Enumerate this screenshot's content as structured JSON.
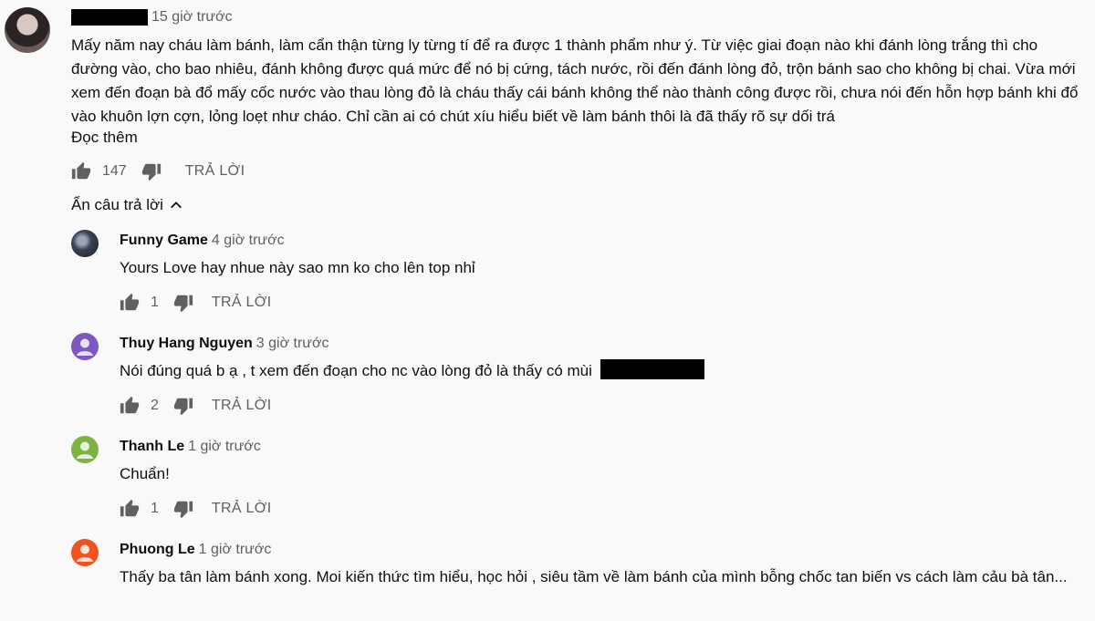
{
  "top_comment": {
    "time": "15 giờ trước",
    "text": "Mấy năm nay cháu làm bánh, làm cẩn thận từng ly từng tí để ra được 1 thành phẩm như ý. Từ việc giai đoạn nào khi đánh lòng trắng thì cho đường vào, cho bao nhiêu, đánh không được quá mức để nó bị cứng, tách nước, rồi đến đánh lòng đỏ, trộn bánh sao cho không bị chai. Vừa mới xem đến đoạn bà đổ mấy cốc nước vào thau lòng đỏ là cháu thấy cái bánh không thể nào thành công được rồi, chưa nói đến hỗn hợp bánh khi đổ vào khuôn lợn cợn, lỏng loẹt như cháo. Chỉ cần ai có chút xíu hiểu biết về làm bánh thôi là đã thấy rõ sự dối trá",
    "read_more": "Đọc thêm",
    "likes": "147",
    "reply_label": "TRẢ LỜI"
  },
  "toggle_label": "Ẩn câu trả lời",
  "replies": [
    {
      "author": "Funny Game",
      "time": "4 giờ trước",
      "text": "Yours Love hay nhue này sao mn ko cho lên top nhỉ",
      "likes": "1",
      "reply_label": "TRẢ LỜI",
      "avatar_color": "#3a4150"
    },
    {
      "author": "Thuy Hang Nguyen",
      "time": "3 giờ trước",
      "text": "Nói đúng quá b ạ , t xem đến đoạn cho nc vào lòng đỏ là thấy có mùi",
      "likes": "2",
      "reply_label": "TRẢ LỜI",
      "avatar_color": "#7e57c2"
    },
    {
      "author": "Thanh Le",
      "time": "1 giờ trước",
      "text": "Chuẩn!",
      "likes": "1",
      "reply_label": "TRẢ LỜI",
      "avatar_color": "#7cb342"
    },
    {
      "author": "Phuong Le",
      "time": "1 giờ trước",
      "text": "Thấy ba tân làm bánh xong. Moi kiến thức tìm hiểu, học hỏi , siêu tầm về làm bánh của mình bỗng chốc tan biến vs cách làm cảu bà tân...",
      "likes": "",
      "reply_label": "",
      "avatar_color": "#f4511e"
    }
  ],
  "icons": {
    "like": "thumb-up-icon",
    "dislike": "thumb-down-icon",
    "toggle": "chevron-up-icon",
    "avatar": "person-avatar-icon"
  }
}
